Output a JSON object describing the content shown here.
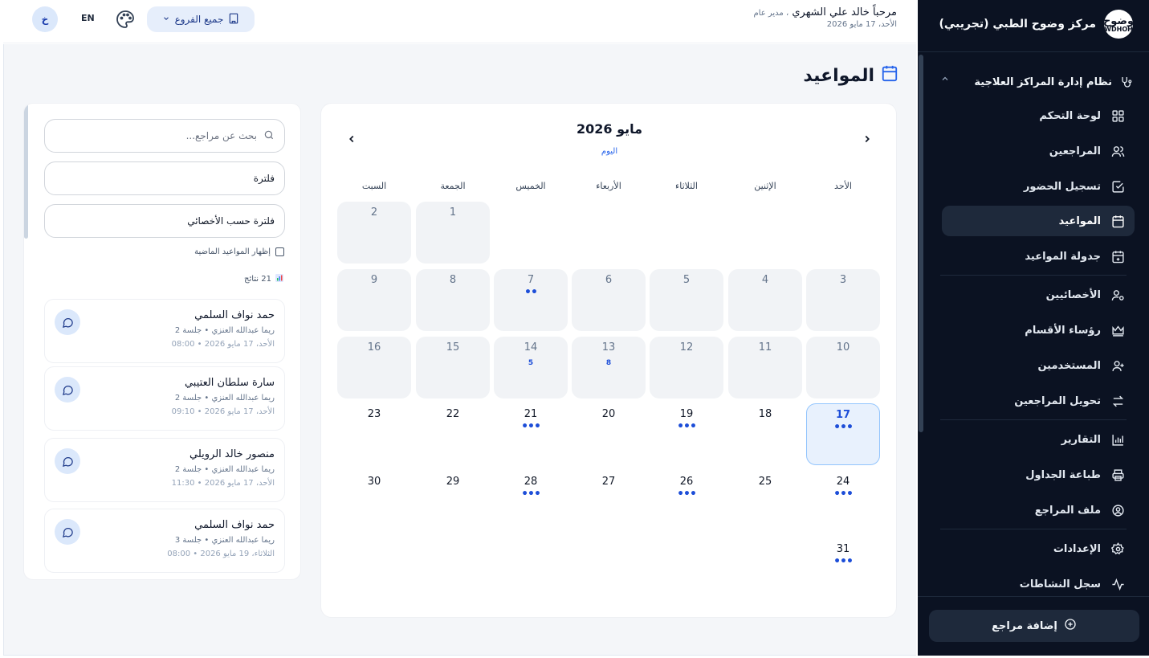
{
  "sidebar": {
    "brand_name": "مركز وضوح الطبي (تجريبي)",
    "logo_top": "وضوح",
    "logo_bottom": "WDHOH",
    "system_title": "نظام إدارة المراكز العلاجية",
    "items": [
      {
        "label": "لوحة التحكم",
        "icon": "dashboard-icon"
      },
      {
        "label": "المراجعين",
        "icon": "users-icon"
      },
      {
        "label": "تسجيل الحضور",
        "icon": "check-square-icon"
      },
      {
        "label": "المواعيد",
        "icon": "calendar-icon",
        "active": true
      },
      {
        "label": "جدولة المواعيد",
        "icon": "calendar-plus-icon"
      },
      {
        "label": "الأخصائيين",
        "icon": "user-cog-icon"
      },
      {
        "label": "رؤساء الأقسام",
        "icon": "crown-icon"
      },
      {
        "label": "المستخدمين",
        "icon": "user-plus-icon"
      },
      {
        "label": "تحويل المراجعين",
        "icon": "swap-icon"
      },
      {
        "label": "التقارير",
        "icon": "bar-chart-icon"
      },
      {
        "label": "طباعة الجداول",
        "icon": "printer-icon"
      },
      {
        "label": "ملف المراجع",
        "icon": "user-circle-icon"
      },
      {
        "label": "الإعدادات",
        "icon": "gear-icon"
      },
      {
        "label": "سجل النشاطات",
        "icon": "activity-icon"
      }
    ],
    "add_button": "إضافة مراجع"
  },
  "topbar": {
    "greeting_prefix": "مرحباً",
    "user_name": "خالد علي الشهري",
    "role": "، مدير عام",
    "date": "الأحد، 17 مايو 2026",
    "avatar_letter": "خ",
    "lang": "EN",
    "branch_label": "جميع الفروع"
  },
  "page": {
    "title": "المواعيد"
  },
  "calendar": {
    "month_title": "مايو 2026",
    "today_label": "اليوم",
    "weekdays": [
      "الأحد",
      "الإثنين",
      "الثلاثاء",
      "الأربعاء",
      "الخميس",
      "الجمعة",
      "السبت"
    ],
    "days": [
      {
        "n": "1",
        "past": true
      },
      {
        "n": "2",
        "past": true
      },
      {
        "n": "3",
        "past": true
      },
      {
        "n": "4",
        "past": true
      },
      {
        "n": "5",
        "past": true
      },
      {
        "n": "6",
        "past": true
      },
      {
        "n": "7",
        "past": true,
        "dots": "••"
      },
      {
        "n": "8",
        "past": true
      },
      {
        "n": "9",
        "past": true
      },
      {
        "n": "10",
        "past": true
      },
      {
        "n": "11",
        "past": true
      },
      {
        "n": "12",
        "past": true
      },
      {
        "n": "13",
        "past": true,
        "count": "8"
      },
      {
        "n": "14",
        "past": true,
        "count": "5"
      },
      {
        "n": "15",
        "past": true
      },
      {
        "n": "16",
        "past": true
      },
      {
        "n": "17",
        "today": true,
        "dots": "•••"
      },
      {
        "n": "18"
      },
      {
        "n": "19",
        "dots": "•••"
      },
      {
        "n": "20"
      },
      {
        "n": "21",
        "dots": "•••"
      },
      {
        "n": "22"
      },
      {
        "n": "23"
      },
      {
        "n": "24",
        "dots": "•••"
      },
      {
        "n": "25"
      },
      {
        "n": "26",
        "dots": "•••"
      },
      {
        "n": "27"
      },
      {
        "n": "28",
        "dots": "•••"
      },
      {
        "n": "29"
      },
      {
        "n": "30"
      },
      {
        "n": "31",
        "dots": "•••"
      }
    ]
  },
  "list": {
    "search_placeholder": "بحث عن مراجع...",
    "filter1": "فلترة",
    "filter2": "فلترة حسب الأخصائي",
    "past_toggle": "إظهار المواعيد الماضية",
    "results": "21 نتائج",
    "appointments": [
      {
        "name": "حمد نواف السلمي",
        "sub": "ريما عبدالله العنزي • جلسة 2",
        "when": "الأحد، 17 مايو 2026 • 08:00"
      },
      {
        "name": "سارة سلطان العتيبي",
        "sub": "ريما عبدالله العنزي • جلسة 2",
        "when": "الأحد، 17 مايو 2026 • 09:10"
      },
      {
        "name": "منصور خالد الرويلي",
        "sub": "ريما عبدالله العنزي • جلسة 2",
        "when": "الأحد، 17 مايو 2026 • 11:30"
      },
      {
        "name": "حمد نواف السلمي",
        "sub": "ريما عبدالله العنزي • جلسة 3",
        "when": "الثلاثاء، 19 مايو 2026 • 08:00"
      }
    ]
  },
  "colors": {
    "sidebar_bg": "#0b1222",
    "accent": "#2563eb",
    "today_bg": "#e8f1fd"
  }
}
